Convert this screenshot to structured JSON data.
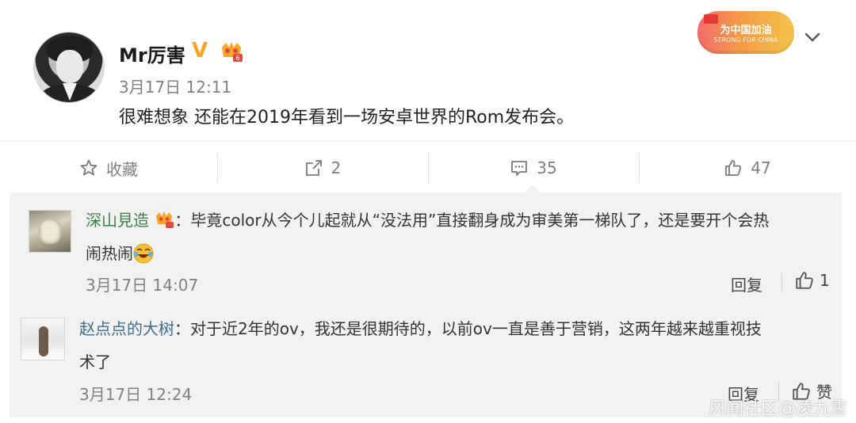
{
  "post": {
    "user_name": "Mr厉害",
    "time": "3月17日 12:11",
    "text": "很难想象 还能在2019年看到一场安卓世界的Rom发布会。",
    "banner": {
      "title": "为中国加油",
      "subtitle": "STRONG FOR CHINA"
    }
  },
  "actions": {
    "favorite_label": "收藏",
    "repost_count": "2",
    "comment_count": "35",
    "like_count": "47"
  },
  "comments": [
    {
      "name": "深山見造",
      "colon": "：",
      "text_line1": "毕竟color从今个儿起就从“没法用”直接翻身成为审美第一梯队了，还是要开个会热",
      "text_line2": "闹热闹",
      "time": "3月17日 14:07",
      "reply_label": "回复",
      "like_count": "1"
    },
    {
      "name": "赵点点的大树",
      "colon": "：",
      "text_line1": "对于近2年的ov，我还是很期待的，以前ov一直是善于营销，这两年越来越重视技",
      "text_line2": "术了",
      "time": "3月17日 12:24",
      "reply_label": "回复",
      "like_label": "赞"
    }
  ],
  "watermark": "风闻社区@凌九霄",
  "colors": {
    "verified": "#f5a623",
    "comment_bg": "#f2f2f2",
    "name_green": "#3f7d4b",
    "name_blue": "#3f6e8c"
  }
}
